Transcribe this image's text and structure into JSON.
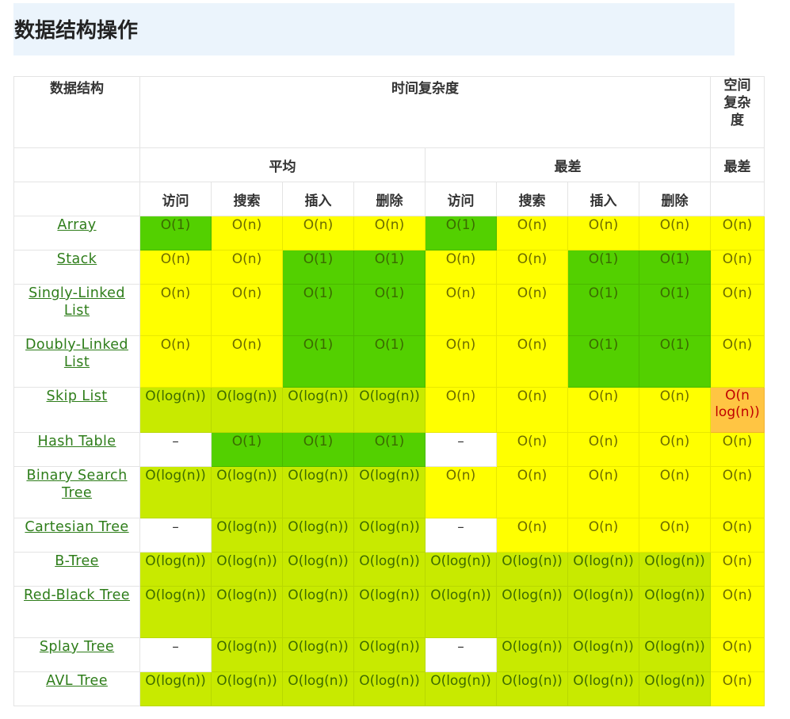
{
  "title": "数据结构操作",
  "header": {
    "data_structure": "数据结构",
    "time_complexity": "时间复杂度",
    "space_complexity": "空间复杂度",
    "space_complexity_lines": [
      "空间",
      "复杂",
      "度"
    ],
    "average": "平均",
    "worst": "最差",
    "space_worst": "最差",
    "ops": [
      "访问",
      "搜索",
      "插入",
      "删除",
      "访问",
      "搜索",
      "插入",
      "删除"
    ]
  },
  "colors": {
    "green": "#53d000",
    "yellow": "#ffff00",
    "lime": "#c8ea00",
    "orange": "#ffc543",
    "link": "#2e7d1a",
    "title_bg": "#ebf4fc"
  },
  "rows": [
    {
      "name": "Array",
      "cells": [
        {
          "v": "O(1)",
          "c": "green"
        },
        {
          "v": "O(n)",
          "c": "yellow"
        },
        {
          "v": "O(n)",
          "c": "yellow"
        },
        {
          "v": "O(n)",
          "c": "yellow"
        },
        {
          "v": "O(1)",
          "c": "green"
        },
        {
          "v": "O(n)",
          "c": "yellow"
        },
        {
          "v": "O(n)",
          "c": "yellow"
        },
        {
          "v": "O(n)",
          "c": "yellow"
        },
        {
          "v": "O(n)",
          "c": "yellow"
        }
      ]
    },
    {
      "name": "Stack",
      "cells": [
        {
          "v": "O(n)",
          "c": "yellow"
        },
        {
          "v": "O(n)",
          "c": "yellow"
        },
        {
          "v": "O(1)",
          "c": "green"
        },
        {
          "v": "O(1)",
          "c": "green"
        },
        {
          "v": "O(n)",
          "c": "yellow"
        },
        {
          "v": "O(n)",
          "c": "yellow"
        },
        {
          "v": "O(1)",
          "c": "green"
        },
        {
          "v": "O(1)",
          "c": "green"
        },
        {
          "v": "O(n)",
          "c": "yellow"
        }
      ]
    },
    {
      "name": "Singly-Linked List",
      "cells": [
        {
          "v": "O(n)",
          "c": "yellow"
        },
        {
          "v": "O(n)",
          "c": "yellow"
        },
        {
          "v": "O(1)",
          "c": "green"
        },
        {
          "v": "O(1)",
          "c": "green"
        },
        {
          "v": "O(n)",
          "c": "yellow"
        },
        {
          "v": "O(n)",
          "c": "yellow"
        },
        {
          "v": "O(1)",
          "c": "green"
        },
        {
          "v": "O(1)",
          "c": "green"
        },
        {
          "v": "O(n)",
          "c": "yellow"
        }
      ]
    },
    {
      "name": "Doubly-Linked List",
      "cells": [
        {
          "v": "O(n)",
          "c": "yellow"
        },
        {
          "v": "O(n)",
          "c": "yellow"
        },
        {
          "v": "O(1)",
          "c": "green"
        },
        {
          "v": "O(1)",
          "c": "green"
        },
        {
          "v": "O(n)",
          "c": "yellow"
        },
        {
          "v": "O(n)",
          "c": "yellow"
        },
        {
          "v": "O(1)",
          "c": "green"
        },
        {
          "v": "O(1)",
          "c": "green"
        },
        {
          "v": "O(n)",
          "c": "yellow"
        }
      ]
    },
    {
      "name": "Skip List",
      "cells": [
        {
          "v": "O(log(n))",
          "c": "lime"
        },
        {
          "v": "O(log(n))",
          "c": "lime"
        },
        {
          "v": "O(log(n))",
          "c": "lime"
        },
        {
          "v": "O(log(n))",
          "c": "lime"
        },
        {
          "v": "O(n)",
          "c": "yellow"
        },
        {
          "v": "O(n)",
          "c": "yellow"
        },
        {
          "v": "O(n)",
          "c": "yellow"
        },
        {
          "v": "O(n)",
          "c": "yellow"
        },
        {
          "v": "O(n log(n))",
          "c": "orange"
        }
      ]
    },
    {
      "name": "Hash Table",
      "cells": [
        {
          "v": "–",
          "c": "white"
        },
        {
          "v": "O(1)",
          "c": "green"
        },
        {
          "v": "O(1)",
          "c": "green"
        },
        {
          "v": "O(1)",
          "c": "green"
        },
        {
          "v": "–",
          "c": "white"
        },
        {
          "v": "O(n)",
          "c": "yellow"
        },
        {
          "v": "O(n)",
          "c": "yellow"
        },
        {
          "v": "O(n)",
          "c": "yellow"
        },
        {
          "v": "O(n)",
          "c": "yellow"
        }
      ]
    },
    {
      "name": "Binary Search Tree",
      "cells": [
        {
          "v": "O(log(n))",
          "c": "lime"
        },
        {
          "v": "O(log(n))",
          "c": "lime"
        },
        {
          "v": "O(log(n))",
          "c": "lime"
        },
        {
          "v": "O(log(n))",
          "c": "lime"
        },
        {
          "v": "O(n)",
          "c": "yellow"
        },
        {
          "v": "O(n)",
          "c": "yellow"
        },
        {
          "v": "O(n)",
          "c": "yellow"
        },
        {
          "v": "O(n)",
          "c": "yellow"
        },
        {
          "v": "O(n)",
          "c": "yellow"
        }
      ]
    },
    {
      "name": "Cartesian Tree",
      "cells": [
        {
          "v": "–",
          "c": "white"
        },
        {
          "v": "O(log(n))",
          "c": "lime"
        },
        {
          "v": "O(log(n))",
          "c": "lime"
        },
        {
          "v": "O(log(n))",
          "c": "lime"
        },
        {
          "v": "–",
          "c": "white"
        },
        {
          "v": "O(n)",
          "c": "yellow"
        },
        {
          "v": "O(n)",
          "c": "yellow"
        },
        {
          "v": "O(n)",
          "c": "yellow"
        },
        {
          "v": "O(n)",
          "c": "yellow"
        }
      ]
    },
    {
      "name": "B-Tree",
      "cells": [
        {
          "v": "O(log(n))",
          "c": "lime"
        },
        {
          "v": "O(log(n))",
          "c": "lime"
        },
        {
          "v": "O(log(n))",
          "c": "lime"
        },
        {
          "v": "O(log(n))",
          "c": "lime"
        },
        {
          "v": "O(log(n))",
          "c": "lime"
        },
        {
          "v": "O(log(n))",
          "c": "lime"
        },
        {
          "v": "O(log(n))",
          "c": "lime"
        },
        {
          "v": "O(log(n))",
          "c": "lime"
        },
        {
          "v": "O(n)",
          "c": "yellow"
        }
      ]
    },
    {
      "name": "Red-Black Tree",
      "cells": [
        {
          "v": "O(log(n))",
          "c": "lime"
        },
        {
          "v": "O(log(n))",
          "c": "lime"
        },
        {
          "v": "O(log(n))",
          "c": "lime"
        },
        {
          "v": "O(log(n))",
          "c": "lime"
        },
        {
          "v": "O(log(n))",
          "c": "lime"
        },
        {
          "v": "O(log(n))",
          "c": "lime"
        },
        {
          "v": "O(log(n))",
          "c": "lime"
        },
        {
          "v": "O(log(n))",
          "c": "lime"
        },
        {
          "v": "O(n)",
          "c": "yellow"
        }
      ]
    },
    {
      "name": "Splay Tree",
      "cells": [
        {
          "v": "–",
          "c": "white"
        },
        {
          "v": "O(log(n))",
          "c": "lime"
        },
        {
          "v": "O(log(n))",
          "c": "lime"
        },
        {
          "v": "O(log(n))",
          "c": "lime"
        },
        {
          "v": "–",
          "c": "white"
        },
        {
          "v": "O(log(n))",
          "c": "lime"
        },
        {
          "v": "O(log(n))",
          "c": "lime"
        },
        {
          "v": "O(log(n))",
          "c": "lime"
        },
        {
          "v": "O(n)",
          "c": "yellow"
        }
      ]
    },
    {
      "name": "AVL Tree",
      "cells": [
        {
          "v": "O(log(n))",
          "c": "lime"
        },
        {
          "v": "O(log(n))",
          "c": "lime"
        },
        {
          "v": "O(log(n))",
          "c": "lime"
        },
        {
          "v": "O(log(n))",
          "c": "lime"
        },
        {
          "v": "O(log(n))",
          "c": "lime"
        },
        {
          "v": "O(log(n))",
          "c": "lime"
        },
        {
          "v": "O(log(n))",
          "c": "lime"
        },
        {
          "v": "O(log(n))",
          "c": "lime"
        },
        {
          "v": "O(n)",
          "c": "yellow"
        }
      ]
    }
  ]
}
